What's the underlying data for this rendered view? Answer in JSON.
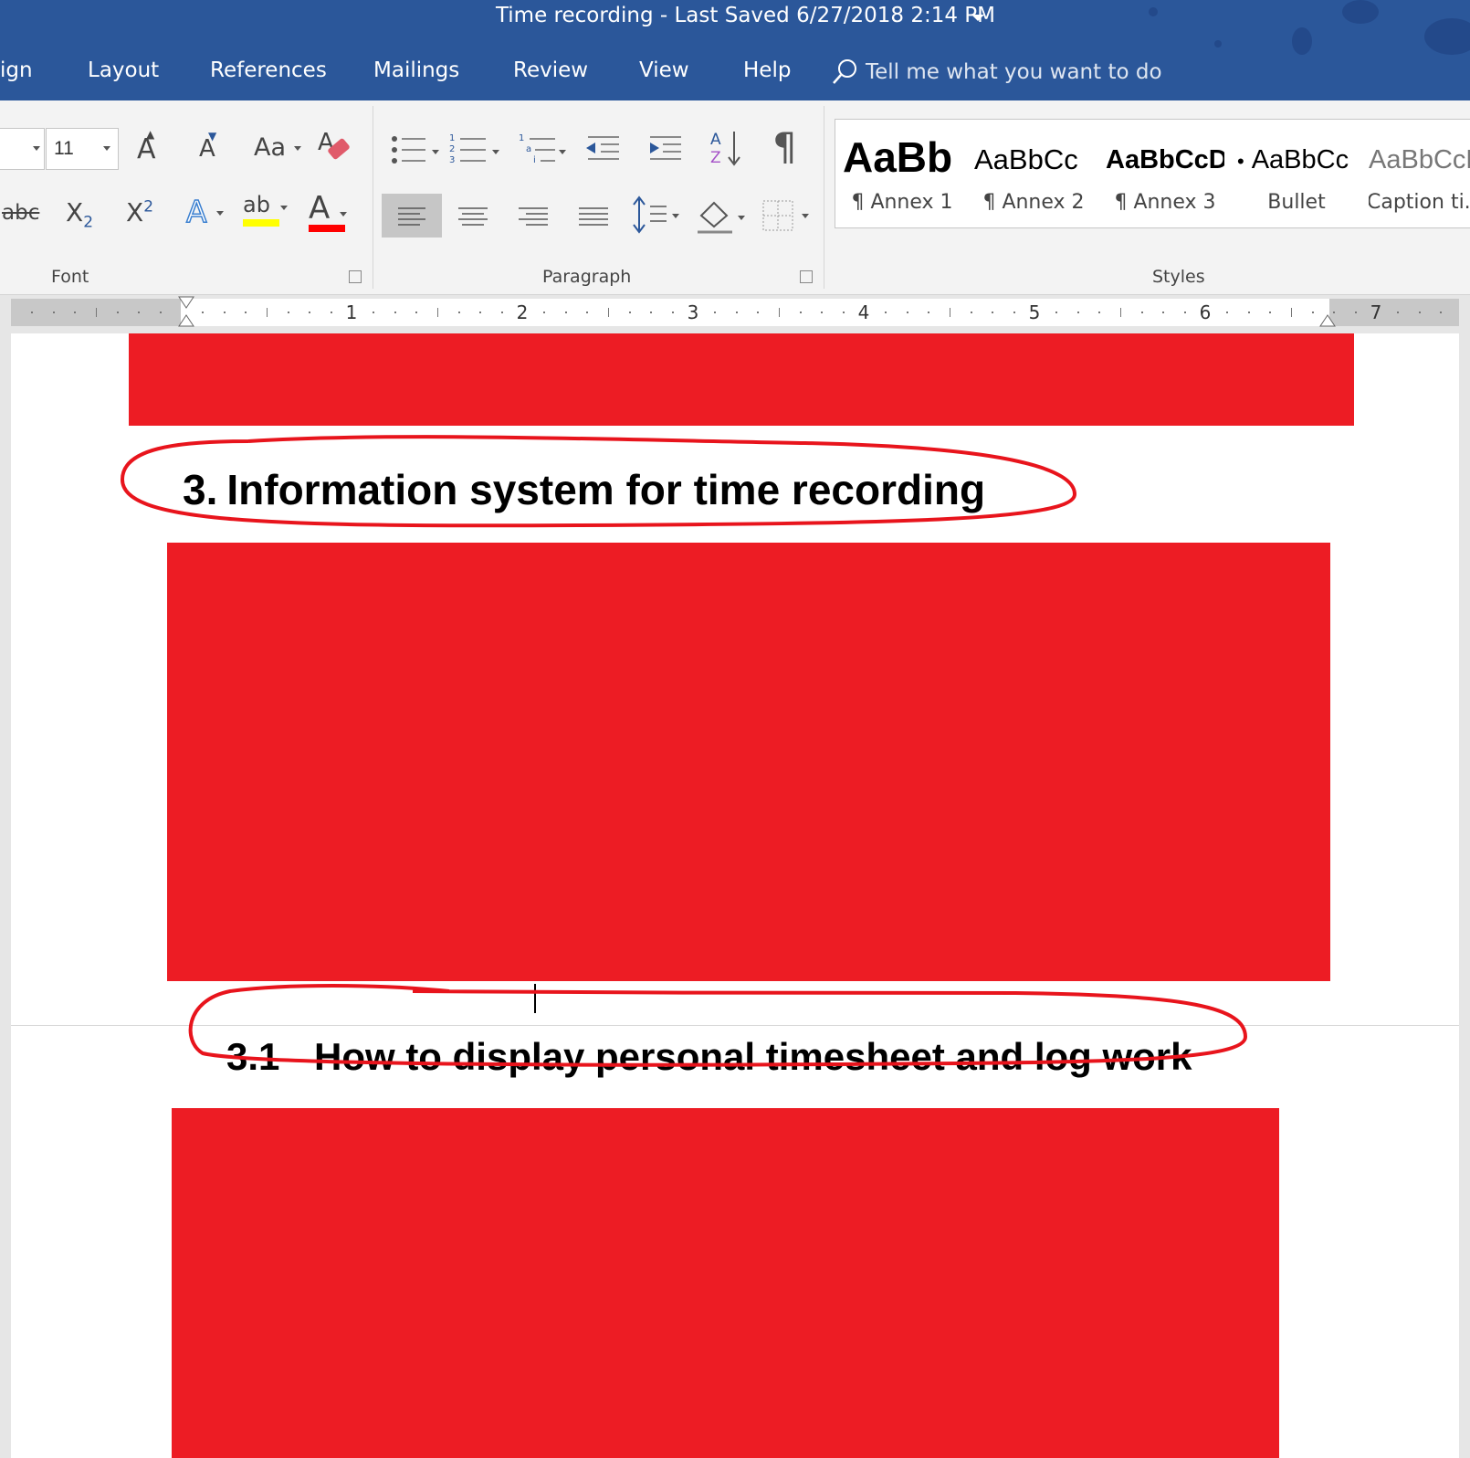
{
  "window": {
    "title": "Time recording  -  Last Saved 6/27/2018 2:14 PM"
  },
  "tabs": [
    {
      "label": "ign"
    },
    {
      "label": "Layout"
    },
    {
      "label": "References"
    },
    {
      "label": "Mailings"
    },
    {
      "label": "Review"
    },
    {
      "label": "View"
    },
    {
      "label": "Help"
    }
  ],
  "tell_me": {
    "placeholder": "Tell me what you want to do"
  },
  "ribbon": {
    "font": {
      "label": "Font",
      "size_value": "11",
      "grow_label": "A",
      "shrink_label": "A",
      "case_label": "Aa",
      "strike_label": "abc",
      "subscript_label": "X",
      "subscript_mark": "2",
      "superscript_label": "X",
      "superscript_mark": "2",
      "effects_label": "A",
      "highlight_label": "ab",
      "color_label": "A",
      "highlight_color": "#ffff00",
      "font_color": "#ff0000"
    },
    "paragraph": {
      "label": "Paragraph",
      "pilcrow": "¶"
    },
    "styles": {
      "label": "Styles",
      "items": [
        {
          "sample": "AaBb",
          "name": "¶ Annex 1"
        },
        {
          "sample": "AaBbCc",
          "name": "¶ Annex 2"
        },
        {
          "sample": "AaBbCcD",
          "name": "¶ Annex 3"
        },
        {
          "sample": "AaBbCc",
          "bullet": "•",
          "name": "Bullet"
        },
        {
          "sample": "AaBbCcD",
          "name": "Caption ti..."
        }
      ]
    }
  },
  "ruler": {
    "numbers": [
      "1",
      "2",
      "3",
      "4",
      "5",
      "6",
      "7"
    ]
  },
  "document": {
    "heading_1": {
      "number": "3.",
      "text": "Information system for time recording"
    },
    "heading_2": {
      "number": "3.1",
      "text": "How to display personal timesheet and log work"
    },
    "redaction_color": "#ed1c24",
    "annotation_color": "#e8141c"
  }
}
